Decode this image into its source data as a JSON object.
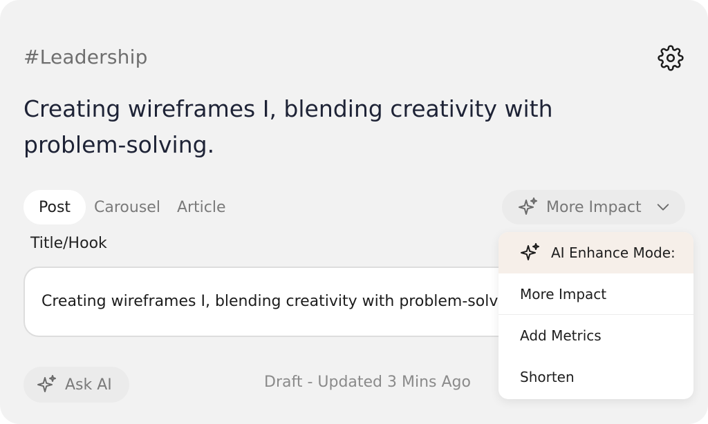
{
  "post": {
    "hashtag": "#Leadership",
    "headline": "Creating wireframes I, blending creativity with problem-solving."
  },
  "tabs": [
    {
      "label": "Post",
      "active": true
    },
    {
      "label": "Carousel",
      "active": false
    },
    {
      "label": "Article",
      "active": false
    }
  ],
  "enhance_button": {
    "label": "More Impact",
    "icon": "sparkle-icon"
  },
  "field": {
    "label": "Title/Hook",
    "value": "Creating wireframes I, blending creativity with problem-solving."
  },
  "ask_ai": {
    "label": "Ask AI",
    "icon": "sparkle-icon"
  },
  "status": {
    "text": "Draft - Updated 3 Mins Ago"
  },
  "menu": {
    "header": "AI Enhance Mode:",
    "items": [
      "More Impact",
      "Add Metrics",
      "Shorten"
    ]
  },
  "colors": {
    "card_bg": "#f2f2f2",
    "menu_header_bg": "#f6efe9",
    "text_dark": "#1e2336",
    "text_muted": "#7a7a7a"
  }
}
